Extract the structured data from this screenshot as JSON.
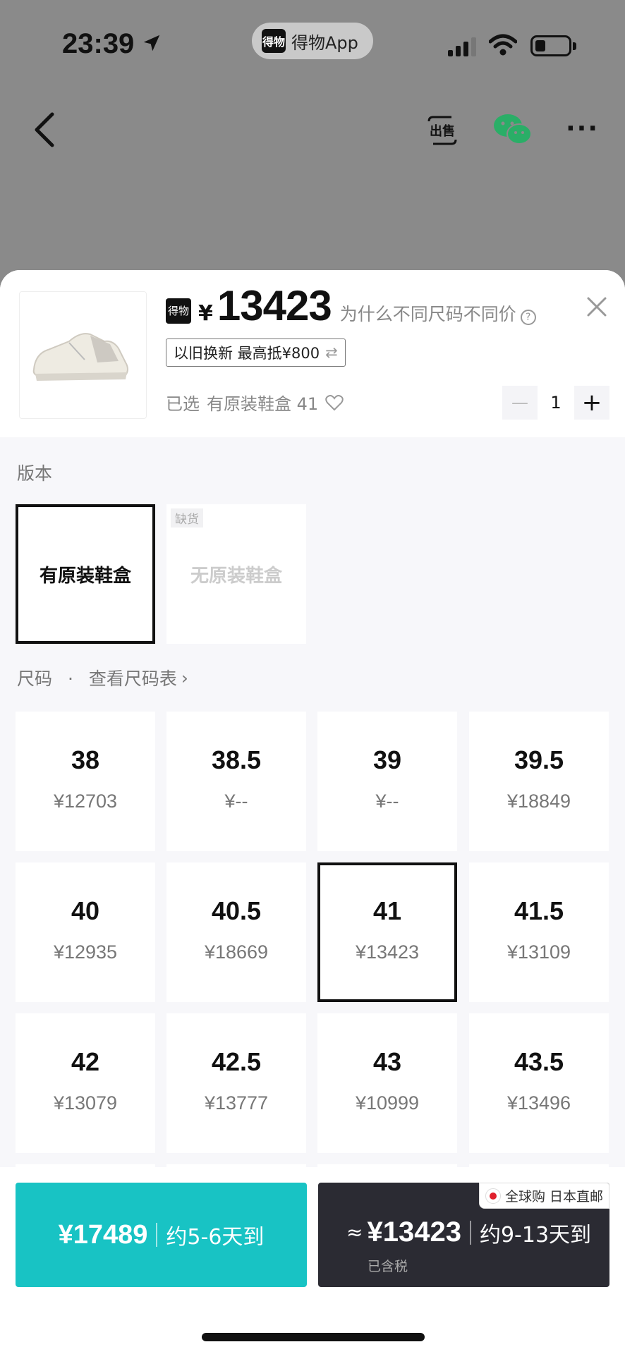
{
  "status_bar": {
    "time": "23:39",
    "app_badge": "得物",
    "app_name": "得物App"
  },
  "nav": {
    "sell_label": "出售",
    "more_label": "···"
  },
  "product": {
    "brand_badge": "得物",
    "currency": "¥",
    "price": "13423",
    "why_text": "为什么不同尺码不同价",
    "help_glyph": "?",
    "trade_in": "以旧换新 最高抵¥800",
    "trade_swap": "⇄",
    "selected_label": "已选",
    "selected_value": "有原装鞋盒 41",
    "quantity": "1",
    "minus": "—",
    "plus": "+"
  },
  "version": {
    "label": "版本",
    "options": [
      {
        "name": "有原装鞋盒",
        "state": "selected"
      },
      {
        "name": "无原装鞋盒",
        "state": "out_of_stock",
        "badge": "缺货"
      }
    ]
  },
  "size": {
    "label": "尺码",
    "separator": "·",
    "chart_link": "查看尺码表",
    "chevron": "›",
    "options": [
      {
        "size": "38",
        "price": "¥12703"
      },
      {
        "size": "38.5",
        "price": "¥--"
      },
      {
        "size": "39",
        "price": "¥--"
      },
      {
        "size": "39.5",
        "price": "¥18849"
      },
      {
        "size": "40",
        "price": "¥12935"
      },
      {
        "size": "40.5",
        "price": "¥18669"
      },
      {
        "size": "41",
        "price": "¥13423",
        "selected": true
      },
      {
        "size": "41.5",
        "price": "¥13109"
      },
      {
        "size": "42",
        "price": "¥13079"
      },
      {
        "size": "42.5",
        "price": "¥13777"
      },
      {
        "size": "43",
        "price": "¥10999"
      },
      {
        "size": "43.5",
        "price": "¥13496"
      }
    ]
  },
  "bottom": {
    "fast_price": "¥17489",
    "fast_eta": "约5-6天到",
    "global_tag": "全球购 日本直邮",
    "approx": "≈",
    "global_price": "¥13423",
    "global_eta": "约9-13天到",
    "tax_note": "已含税"
  },
  "colors": {
    "accent": "#18c3c4",
    "dark_button": "#2b2b33",
    "backdrop": "#8a8a8a"
  },
  "icons": [
    "location-arrow-icon",
    "signal-icon",
    "wifi-icon",
    "battery-icon",
    "back-icon",
    "sell-icon",
    "wechat-icon",
    "more-icon",
    "close-icon",
    "help-icon",
    "heart-icon",
    "swap-icon",
    "chevron-right-icon",
    "japan-flag-icon"
  ]
}
